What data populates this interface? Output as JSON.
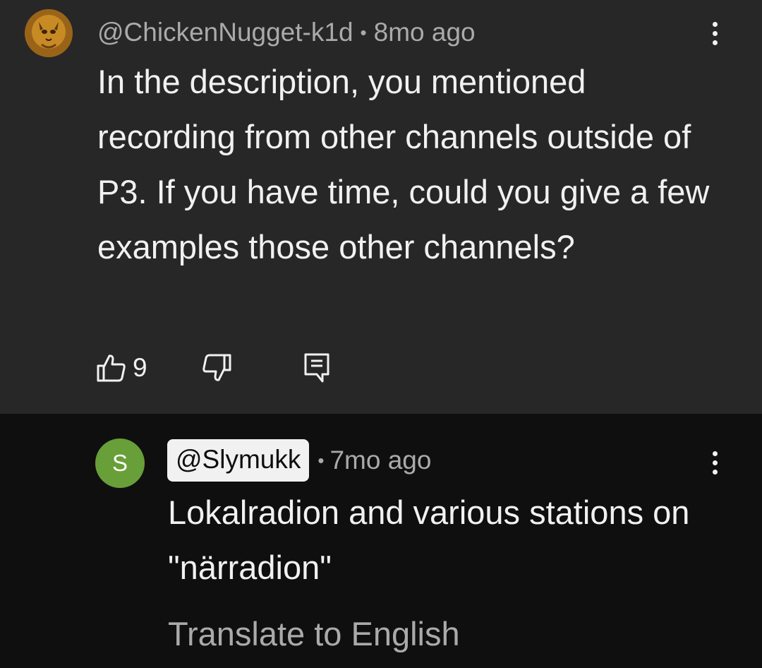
{
  "comment": {
    "author": "@ChickenNugget-k1d",
    "separator": "•",
    "timestamp": "8mo ago",
    "text": "In the description, you mentioned recording from other channels outside of P3. If you have time, could you give a few examples those other channels?",
    "like_count": "9",
    "icons": {
      "avatar": "avatar-image",
      "menu": "more-vert-icon",
      "like": "thumbs-up-icon",
      "dislike": "thumbs-down-icon",
      "reply": "reply-comment-icon"
    }
  },
  "reply": {
    "avatar_letter": "S",
    "avatar_color": "#689f38",
    "author": "@Slymukk",
    "separator": "•",
    "timestamp": "7mo ago",
    "text": "Lokalradion and various stations on \"närradion\"",
    "translate_label": "Translate to English",
    "icons": {
      "menu": "more-vert-icon"
    }
  },
  "colors": {
    "highlight_bg": "#272727",
    "page_bg": "#0f0f0f",
    "text_primary": "#f1f1f1",
    "text_secondary": "#aaaaaa"
  }
}
